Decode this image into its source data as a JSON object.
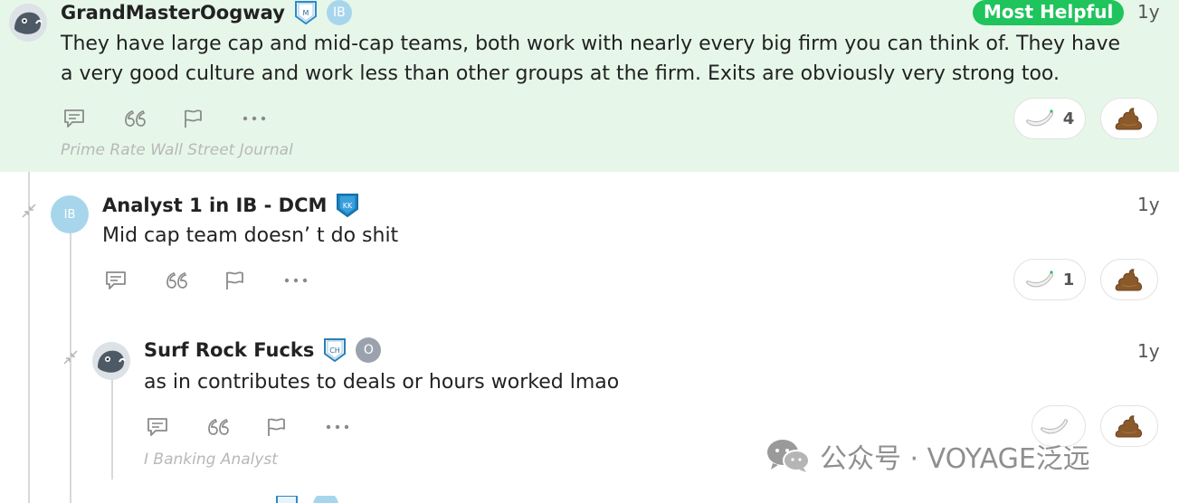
{
  "comments": [
    {
      "author": "GrandMasterOogway",
      "rank_badge": "M",
      "industry_badge": "IB",
      "most_helpful_label": "Most Helpful",
      "time": "1y",
      "body_line1": "They have large cap and mid-cap teams, both work with nearly every big firm you can think of. They have",
      "body_line2": "a very good culture and work less than other groups at the firm. Exits are obviously very strong too.",
      "banana_count": "4",
      "signature": "Prime Rate Wall Street Journal"
    },
    {
      "author": "Analyst 1 in IB - DCM",
      "avatar_text": "IB",
      "rank_badge": "KK",
      "time": "1y",
      "body": "Mid cap team doesn’ t do shit",
      "banana_count": "1"
    },
    {
      "author": "Surf Rock Fucks",
      "rank_badge": "CH",
      "industry_badge": "O",
      "time": "1y",
      "body": "as in contributes to deals or hours worked lmao",
      "banana_count": "",
      "signature": "I Banking Analyst"
    }
  ],
  "watermark": {
    "text": "公众号 · VOYAGE泛远"
  },
  "colors": {
    "highlight_bg": "#e6f7e9",
    "most_helpful": "#1fc45c",
    "badge_ib": "#a7d6ec",
    "badge_o": "#9aa3ad"
  },
  "icons": [
    "reply-icon",
    "quote-icon",
    "flag-icon",
    "more-icon",
    "banana-icon",
    "poop-icon",
    "collapse-icon"
  ]
}
